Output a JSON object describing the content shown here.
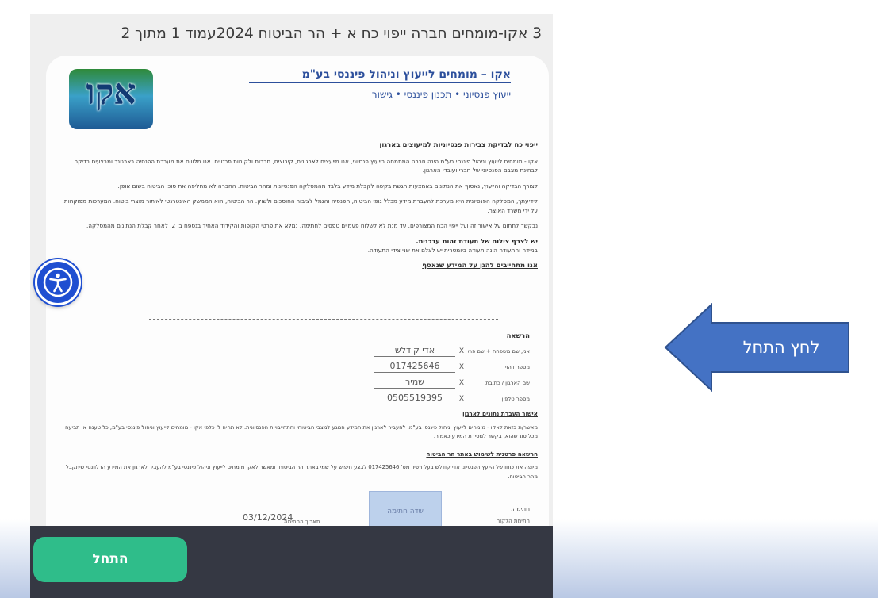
{
  "phone_title": "3 אקו-מומחים חברה ייפוי כח א + הר הביטוח 2024עמוד 1 מתוך 2",
  "logo_text": "אקו",
  "company_name": "אקו – מומחים לייעוץ וניהול פיננסי בע\"מ",
  "company_tagline": "ייעוץ פנסיוני  •  תכנון פיננסי  •  גישור",
  "doc_heading": "ייפוי כח לבדיקת צבירות פנסיוניות למיעוצים בארגון",
  "doc_paragraphs": [
    "אקו - מומחים לייעוץ וניהול פיננסי בע\"מ הינה חברה המתמחה בייעוץ פנסיוני, אנו מייעצים לארגונים, קיבוצים, חברות ולקוחות פרטיים. אנו מלווים את מערכת הפנסיה בארגונך ומבצעים בדיקה לבחינת מצבם הפנסיוני של חברי ועובדי הארגון.",
    "לצורך הבדיקה והייעוץ, נאסוף את הנתונים באמצעות הגשת בקשה לקבלת מידע בלבד מהמסלקה הפנסיונית ומהר הביטוח. החברה לא מחליפה את סוכן הביטוח בשום אופן.",
    "לידיעתך, המסלקה הפנסיונית היא מערכת להעברת מידע מכלל גופי הביטוח, הפנסיה והגמל לציבור החוסכים ולשוק. הר הביטוח, הוא הממשק האינטרנטי לאיתור מוצרי ביטוח. המערכות מפוקחות על ידי משרד האוצר.",
    "נבקשך לחתום על אישור זה ועל ייפוי הכח המצורפים. עד מנת לא לשלוח פעמיים טפסים לחתימה. נמלא את פרטי הקופות והקידוד האחיד בנספח ב' 2, לאחר קבלת הנתונים מהמסלקה."
  ],
  "id_notice_bold": "יש לצרף צילום של תעודת זהות עדכנית.",
  "id_notice_text": "במידה והתעודה הינה תעודה ביומטרית יש לצלם את שני צידי התעודה.",
  "privacy_heading": "אנו מתחייבים להגן על המידע שנאסף",
  "registration_title": "הרשאה",
  "form_rows": [
    {
      "label": "אני, שם משפחה + שם פרטי",
      "value": "אדי קודלש"
    },
    {
      "label": "מספר זיהוי",
      "value": "017425646"
    },
    {
      "label": "שם הארגון / כתובת",
      "value": "שמיר"
    },
    {
      "label": "מספר טלפון",
      "value": "0505519395"
    }
  ],
  "form_x": "X",
  "transfer_heading": "אישור העברת נתונים לארגון",
  "transfer_text": "מאשר/ת בזאת לאקו - מומחים לייעוץ וניהול פיננסי בע\"מ, להעביר לארגון את המידע הנוגע למצבי הביטוחי והתחייבויות הפנסיונית. לא תהיה לי כלפי אקו - מומחים לייעוץ וניהול פיננסי בע\"מ, כל טענה או תביעה מכל סוג שהוא, בקשר למסירת המידע כאמור.",
  "insurance_heading": "הרשאה פרטנית לשימוש באתר הר הביטוח",
  "insurance_text": "מיופה את כוחו של היועץ הפנסיוני אדי קודלש בעל רשיון מס' 017425646 לבצע חיפוש על שמי באתר הר הביטוח. ומאשר לאקו מומחים לייעוץ וניהול פיננסי בע\"מ להעביר לארגון את המידע הרלוונטי שיתקבל מהר הביטוח.",
  "signature_section_label": "חתימה:",
  "signature_box_label": "שדה חתימה",
  "signer_label": "חתימת הלקוח",
  "date_label": "תאריך החתימה",
  "signature_date": "03/12/2024",
  "accessibility_label": "נגישות",
  "start_button_label": "התחל",
  "arrow_callout_label": "לחץ התחל",
  "colors": {
    "start_button": "#2fbd8a",
    "footer_bar": "#353843",
    "arrow": "#4472c4",
    "accessibility": "#1f4fd1",
    "company_text": "#2c4f9c"
  }
}
